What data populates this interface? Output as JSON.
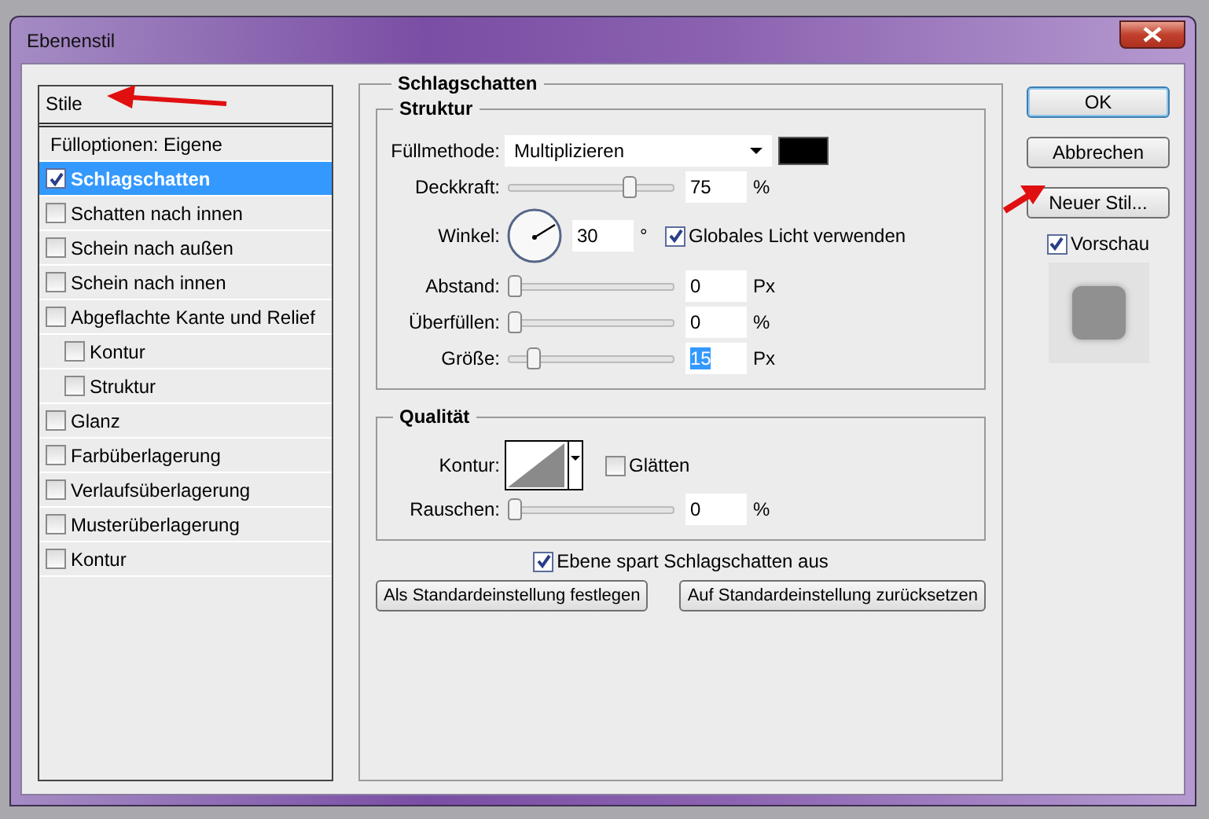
{
  "window": {
    "title": "Ebenenstil"
  },
  "styles_panel": {
    "header": "Stile",
    "items": [
      {
        "label": "Fülloptionen: Eigene",
        "kind": "plain",
        "selected": false
      },
      {
        "label": "Schlagschatten",
        "kind": "check",
        "checked": true,
        "selected": true
      },
      {
        "label": "Schatten nach innen",
        "kind": "check",
        "checked": false,
        "selected": false
      },
      {
        "label": "Schein nach außen",
        "kind": "check",
        "checked": false,
        "selected": false
      },
      {
        "label": "Schein nach innen",
        "kind": "check",
        "checked": false,
        "selected": false
      },
      {
        "label": "Abgeflachte Kante und Relief",
        "kind": "check",
        "checked": false,
        "selected": false,
        "children": [
          {
            "label": "Kontur",
            "kind": "check",
            "checked": false,
            "selected": false
          },
          {
            "label": "Struktur",
            "kind": "check",
            "checked": false,
            "selected": false
          }
        ]
      },
      {
        "label": "Glanz",
        "kind": "check",
        "checked": false,
        "selected": false
      },
      {
        "label": "Farbüberlagerung",
        "kind": "check",
        "checked": false,
        "selected": false
      },
      {
        "label": "Verlaufsüberlagerung",
        "kind": "check",
        "checked": false,
        "selected": false
      },
      {
        "label": "Musterüberlagerung",
        "kind": "check",
        "checked": false,
        "selected": false
      },
      {
        "label": "Kontur",
        "kind": "check",
        "checked": false,
        "selected": false
      }
    ]
  },
  "effect": {
    "title": "Schlagschatten",
    "structure": {
      "title": "Struktur",
      "rows": [
        {
          "kind": "dropdown",
          "label": "Füllmethode:",
          "value": "Multiplizieren",
          "color": "#000000"
        },
        {
          "kind": "slider",
          "label": "Deckkraft:",
          "level": 0.75,
          "value": "75",
          "unit": "%",
          "highlighted": false
        },
        {
          "kind": "angle",
          "label": "Winkel:",
          "value": "30",
          "unit": "°",
          "option": {
            "label": "Globales Licht verwenden",
            "checked": true
          }
        },
        {
          "kind": "slider",
          "label": "Abstand:",
          "level": 0,
          "value": "0",
          "unit": "Px",
          "highlighted": false
        },
        {
          "kind": "slider",
          "label": "Überfüllen:",
          "level": 0,
          "value": "0",
          "unit": "%",
          "highlighted": false
        },
        {
          "kind": "slider",
          "label": "Größe:",
          "level": 0.13,
          "value": "15",
          "unit": "Px",
          "highlighted": true
        }
      ]
    },
    "quality": {
      "title": "Qualität",
      "rows": [
        {
          "kind": "contour",
          "label": "Kontur:",
          "option": {
            "label": "Glätten",
            "checked": false
          }
        },
        {
          "kind": "slider",
          "label": "Rauschen:",
          "level": 0,
          "value": "0",
          "unit": "%",
          "highlighted": false
        }
      ]
    },
    "knockout": {
      "label": "Ebene spart Schlagschatten aus",
      "checked": true
    },
    "buttons": [
      "Als Standardeinstellung festlegen",
      "Auf Standardeinstellung zurücksetzen"
    ]
  },
  "actions": [
    {
      "label": "OK",
      "default": true
    },
    {
      "label": "Abbrechen",
      "default": false
    },
    {
      "label": "Neuer Stil...",
      "default": false
    }
  ],
  "preview": {
    "label": "Vorschau",
    "checked": true
  }
}
